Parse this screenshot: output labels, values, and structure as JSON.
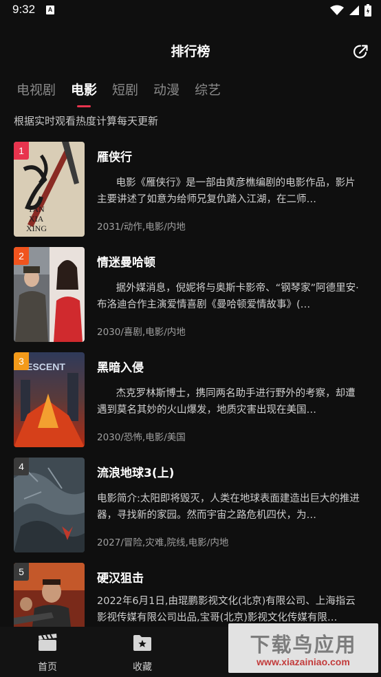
{
  "status_bar": {
    "time": "9:32",
    "notification_glyph": "A",
    "icons": [
      "wifi-icon",
      "signal-icon",
      "battery-icon"
    ]
  },
  "header": {
    "title": "排行榜",
    "share_icon": "share-icon"
  },
  "tabs": [
    {
      "label": "电视剧",
      "active": false
    },
    {
      "label": "电影",
      "active": true
    },
    {
      "label": "短剧",
      "active": false
    },
    {
      "label": "动漫",
      "active": false
    },
    {
      "label": "综艺",
      "active": false
    }
  ],
  "subtitle": "根据实时观看热度计算每天更新",
  "items": [
    {
      "rank": "1",
      "title": "雁侠行",
      "desc": "      电影《雁侠行》是一部由黄彦樵编剧的电影作品，影片主要讲述了如意为给师兄复仇踏入江湖，在二师…",
      "meta": "2031/动作,电影/内地",
      "rank_color": "#e8344e",
      "poster_text": [
        "YAN",
        "XIA",
        "XING"
      ]
    },
    {
      "rank": "2",
      "title": "情迷曼哈顿",
      "desc": "      据外媒消息，倪妮将与奥斯卡影帝、“钢琴家”阿德里安·布洛迪合作主演爱情喜剧《曼哈顿爱情故事》(…",
      "meta": "2030/喜剧,电影/内地",
      "rank_color": "#f0541e"
    },
    {
      "rank": "3",
      "title": "黑暗入侵",
      "desc": "      杰克罗林斯博士，携同两名助手进行野外的考察，却遭遇到莫名其妙的火山爆发，地质灾害出现在美国…",
      "meta": "2030/恐怖,电影/美国",
      "rank_color": "#f39a1a",
      "poster_text": [
        "DESCENT"
      ]
    },
    {
      "rank": "4",
      "title": "流浪地球3(上)",
      "desc": "电影简介:太阳即将毁灭，人类在地球表面建造出巨大的推进器，寻找新的家园。然而宇宙之路危机四伏，为…",
      "meta": "2027/冒险,灾难,院线,电影/内地",
      "rank_color": "#3a3a3a"
    },
    {
      "rank": "5",
      "title": "硬汉狙击",
      "desc": "2022年6月1日,由琨鹏影视文化(北京)有限公司、上海指云影视传媒有限公司出品,宝哥(北京)影视文化传媒有限…",
      "meta": "",
      "rank_color": "#3a3a3a"
    }
  ],
  "bottom_nav": [
    {
      "label": "首页",
      "icon": "clapperboard-icon"
    },
    {
      "label": "收藏",
      "icon": "folder-star-icon"
    }
  ],
  "watermark": {
    "main": "下载鸟应用",
    "sub": "www.xiazainiao.com"
  }
}
